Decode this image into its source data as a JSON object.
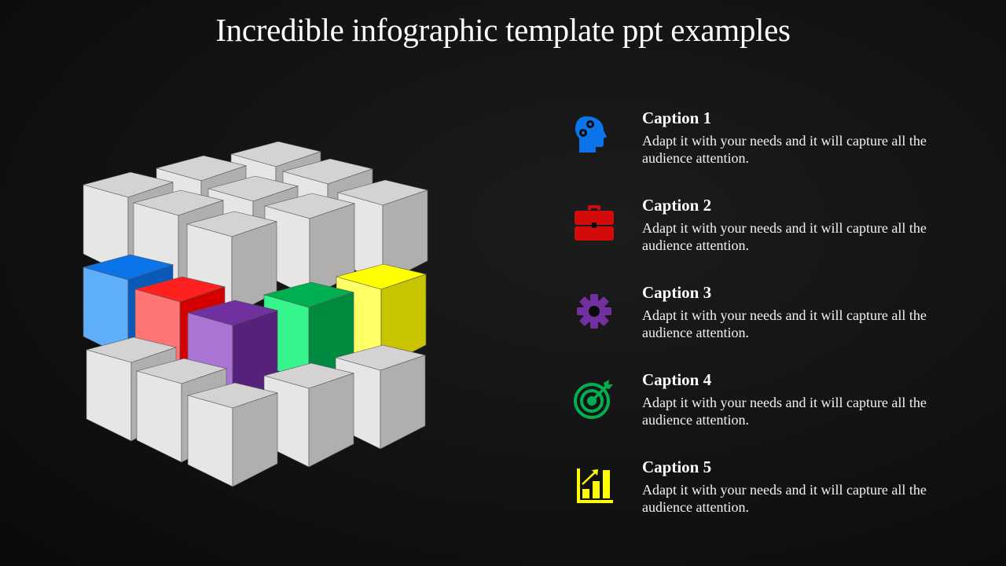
{
  "title": "Incredible infographic template ppt examples",
  "colors": {
    "blue": "#0a74e8",
    "red": "#d40b0b",
    "purple": "#7030a0",
    "green": "#00b050",
    "yellow": "#ffff00",
    "grey_top": "#d4d2d2",
    "grey_left": "#e6e6e6",
    "grey_right": "#b1afae"
  },
  "items": [
    {
      "caption": "Caption 1",
      "text": "Adapt it with your needs and it will capture all the audience attention.",
      "icon": "head-gears-icon",
      "color": "#0a74e8"
    },
    {
      "caption": "Caption 2",
      "text": "Adapt it with your needs and it will capture all the audience attention.",
      "icon": "briefcase-icon",
      "color": "#d40b0b"
    },
    {
      "caption": "Caption 3",
      "text": "Adapt it with your needs and it will capture all the audience attention.",
      "icon": "gear-icon",
      "color": "#7030a0"
    },
    {
      "caption": "Caption 4",
      "text": "Adapt it with your needs and it will capture all the audience attention.",
      "icon": "target-icon",
      "color": "#00b050"
    },
    {
      "caption": "Caption 5",
      "text": "Adapt it with your needs and it will capture all the audience attention.",
      "icon": "growth-chart-icon",
      "color": "#ffff00"
    }
  ],
  "cube_graphic": {
    "colored_cubes": [
      "blue",
      "red",
      "purple",
      "green",
      "yellow"
    ]
  }
}
